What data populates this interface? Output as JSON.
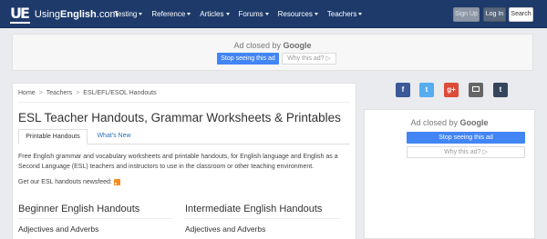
{
  "brand": {
    "logo_mark": "UE",
    "name_prefix": "Using",
    "name_bold": "English",
    "name_suffix": ".com"
  },
  "nav": {
    "items": [
      {
        "label": "Testing"
      },
      {
        "label": "Reference"
      },
      {
        "label": "Articles"
      },
      {
        "label": "Forums"
      },
      {
        "label": "Resources"
      },
      {
        "label": "Teachers"
      }
    ],
    "signup_label": "Sign Up",
    "login_label": "Log In",
    "search_label": "Search"
  },
  "top_ad": {
    "closed_text": "Ad closed by",
    "google_text": "Google",
    "stop_label": "Stop seeing this ad",
    "why_label": "Why this ad? ▷"
  },
  "breadcrumb": {
    "items": [
      "Home",
      "Teachers",
      "ESL/EFL/ESOL Handouts"
    ],
    "separator": ">"
  },
  "page_title": "ESL Teacher Handouts, Grammar Worksheets & Printables",
  "tabs": [
    {
      "label": "Printable Handouts",
      "active": true
    },
    {
      "label": "What's New",
      "active": false
    }
  ],
  "intro_text": "Free English grammar and vocabulary worksheets and printable handouts, for English language and English as a Second Language (ESL) teachers and instructors to use in the classroom or other teaching environment.",
  "newsfeed_text": "Get our ESL handouts newsfeed:",
  "columns": [
    {
      "heading": "Beginner English Handouts",
      "first_item": "Adjectives and Adverbs"
    },
    {
      "heading": "Intermediate English Handouts",
      "first_item": "Adjectives and Adverbs"
    }
  ],
  "share_buttons": [
    {
      "label": "f",
      "icon": "facebook-icon"
    },
    {
      "label": "t",
      "icon": "twitter-icon"
    },
    {
      "label": "g+",
      "icon": "google-plus-icon"
    },
    {
      "label": "",
      "icon": "email-icon"
    },
    {
      "label": "t",
      "icon": "tumblr-icon"
    }
  ],
  "side_ad": {
    "closed_text": "Ad closed by",
    "google_text": "Google",
    "stop_label": "Stop seeing this ad",
    "why_label": "Why this ad? ▷"
  },
  "colors": {
    "navbar": "#1d3a6b",
    "link": "#2a6ebb",
    "ad_button": "#4285f4",
    "rss": "#f68b1f"
  }
}
